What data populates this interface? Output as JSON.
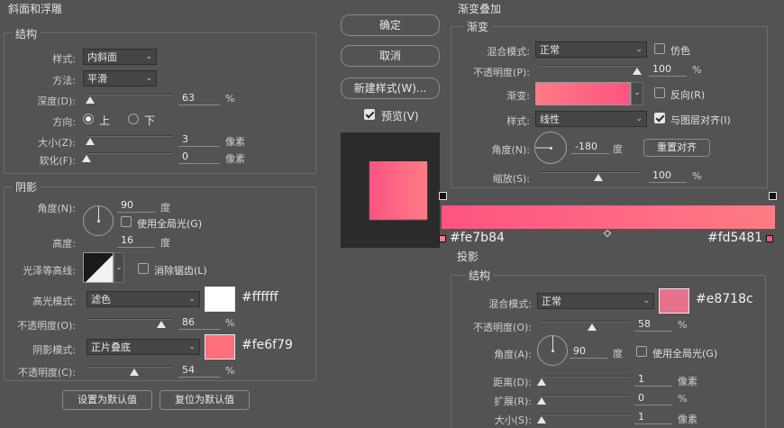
{
  "bevel": {
    "title": "斜面和浮雕",
    "structure_title": "结构",
    "style_label": "样式:",
    "style_value": "内斜面",
    "technique_label": "方法:",
    "technique_value": "平滑",
    "depth_label": "深度(D):",
    "depth_value": "63",
    "depth_unit": "%",
    "direction_label": "方向:",
    "direction_up": "上",
    "direction_down": "下",
    "size_label": "大小(Z):",
    "size_value": "3",
    "size_unit": "像素",
    "soften_label": "软化(F):",
    "soften_value": "0",
    "soften_unit": "像素",
    "shading_title": "阴影",
    "angle_label": "角度(N):",
    "angle_value": "90",
    "angle_unit": "度",
    "global_light_label": "使用全局光(G)",
    "altitude_label": "高度:",
    "altitude_value": "16",
    "altitude_unit": "度",
    "gloss_label": "光泽等高线:",
    "antialias_label": "消除锯齿(L)",
    "highlight_mode_label": "高光模式:",
    "highlight_mode_value": "滤色",
    "highlight_color": "#ffffff",
    "highlight_hex": "#ffffff",
    "highlight_opacity_label": "不透明度(O):",
    "highlight_opacity_value": "86",
    "highlight_opacity_unit": "%",
    "shadow_mode_label": "阴影模式:",
    "shadow_mode_value": "正片叠底",
    "shadow_color": "#fe6f79",
    "shadow_hex": "#fe6f79",
    "shadow_opacity_label": "不透明度(C):",
    "shadow_opacity_value": "54",
    "shadow_opacity_unit": "%",
    "make_default": "设置为默认值",
    "reset_default": "复位为默认值"
  },
  "buttons": {
    "ok": "确定",
    "cancel": "取消",
    "new_style": "新建样式(W)...",
    "preview": "预览(V)"
  },
  "gradient_overlay": {
    "title": "渐变叠加",
    "subtitle": "渐变",
    "blend_label": "混合模式:",
    "blend_value": "正常",
    "dither_label": "仿色",
    "opacity_label": "不透明度(P):",
    "opacity_value": "100",
    "opacity_unit": "%",
    "gradient_label": "渐变:",
    "reverse_label": "反向(R)",
    "style_label": "样式:",
    "style_value": "线性",
    "align_label": "与图层对齐(I)",
    "angle_label": "角度(N):",
    "angle_value": "-180",
    "angle_unit": "度",
    "reset_align": "重置对齐",
    "scale_label": "缩放(S):",
    "scale_value": "100",
    "scale_unit": "%",
    "color_left": "#fe7b84",
    "color_right": "#fd5481",
    "stop_left_hex": "#fe7b84",
    "stop_right_hex": "#fd5481"
  },
  "drop_shadow": {
    "title": "投影",
    "structure_title": "结构",
    "blend_label": "混合模式:",
    "blend_value": "正常",
    "color": "#e8718c",
    "color_hex": "#e8718c",
    "opacity_label": "不透明度(O):",
    "opacity_value": "58",
    "opacity_unit": "%",
    "angle_label": "角度(A):",
    "angle_value": "90",
    "angle_unit": "度",
    "global_light_label": "使用全局光(G)",
    "distance_label": "距离(D):",
    "distance_value": "1",
    "distance_unit": "像素",
    "spread_label": "扩展(R):",
    "spread_value": "0",
    "spread_unit": "%",
    "size_label": "大小(S):",
    "size_value": "1",
    "size_unit": "像素"
  }
}
